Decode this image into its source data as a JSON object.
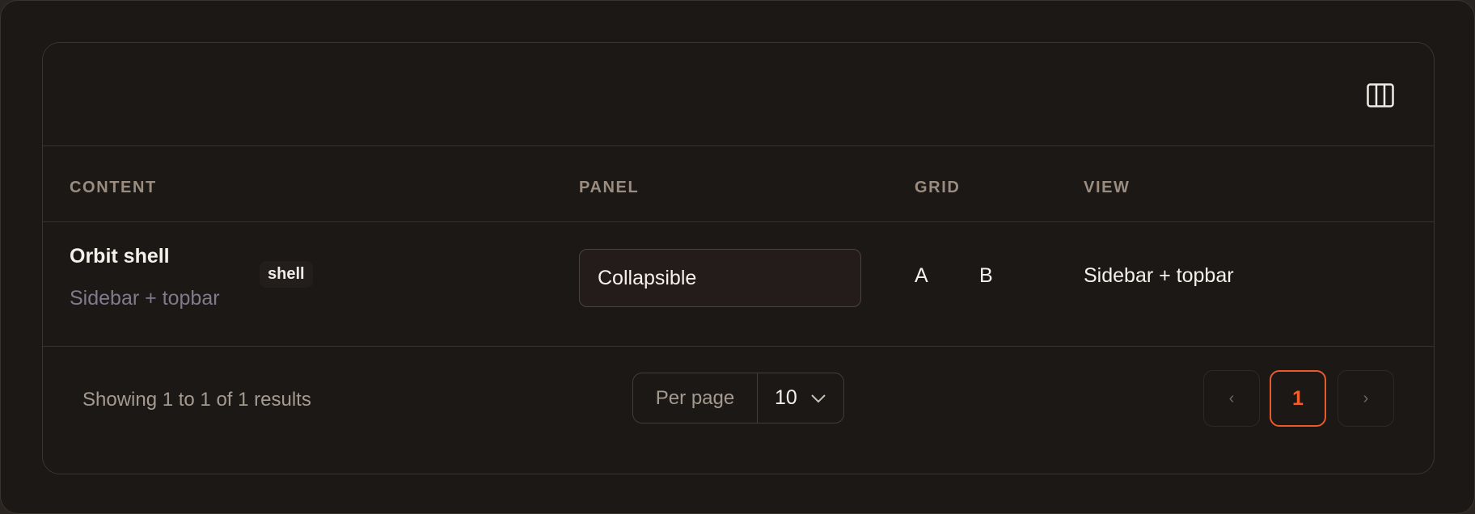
{
  "toolbar": {
    "columns_icon": "columns-icon"
  },
  "table": {
    "headers": {
      "content": "CONTENT",
      "panel": "PANEL",
      "grid": "GRID",
      "view": "VIEW"
    },
    "rows": [
      {
        "title": "Orbit shell",
        "subtitle": "Sidebar + topbar",
        "tag": "shell",
        "panel": "Collapsible",
        "grid_a": "A",
        "grid_b": "B",
        "view": "Sidebar + topbar"
      }
    ]
  },
  "footer": {
    "showing": "Showing 1 to 1 of 1 results",
    "per_page_label": "Per page",
    "per_page_value": "10",
    "prev_label": "‹",
    "current_page": "1",
    "next_label": "›"
  },
  "colors": {
    "accent": "#ef5f2c",
    "background": "#1c1815"
  }
}
